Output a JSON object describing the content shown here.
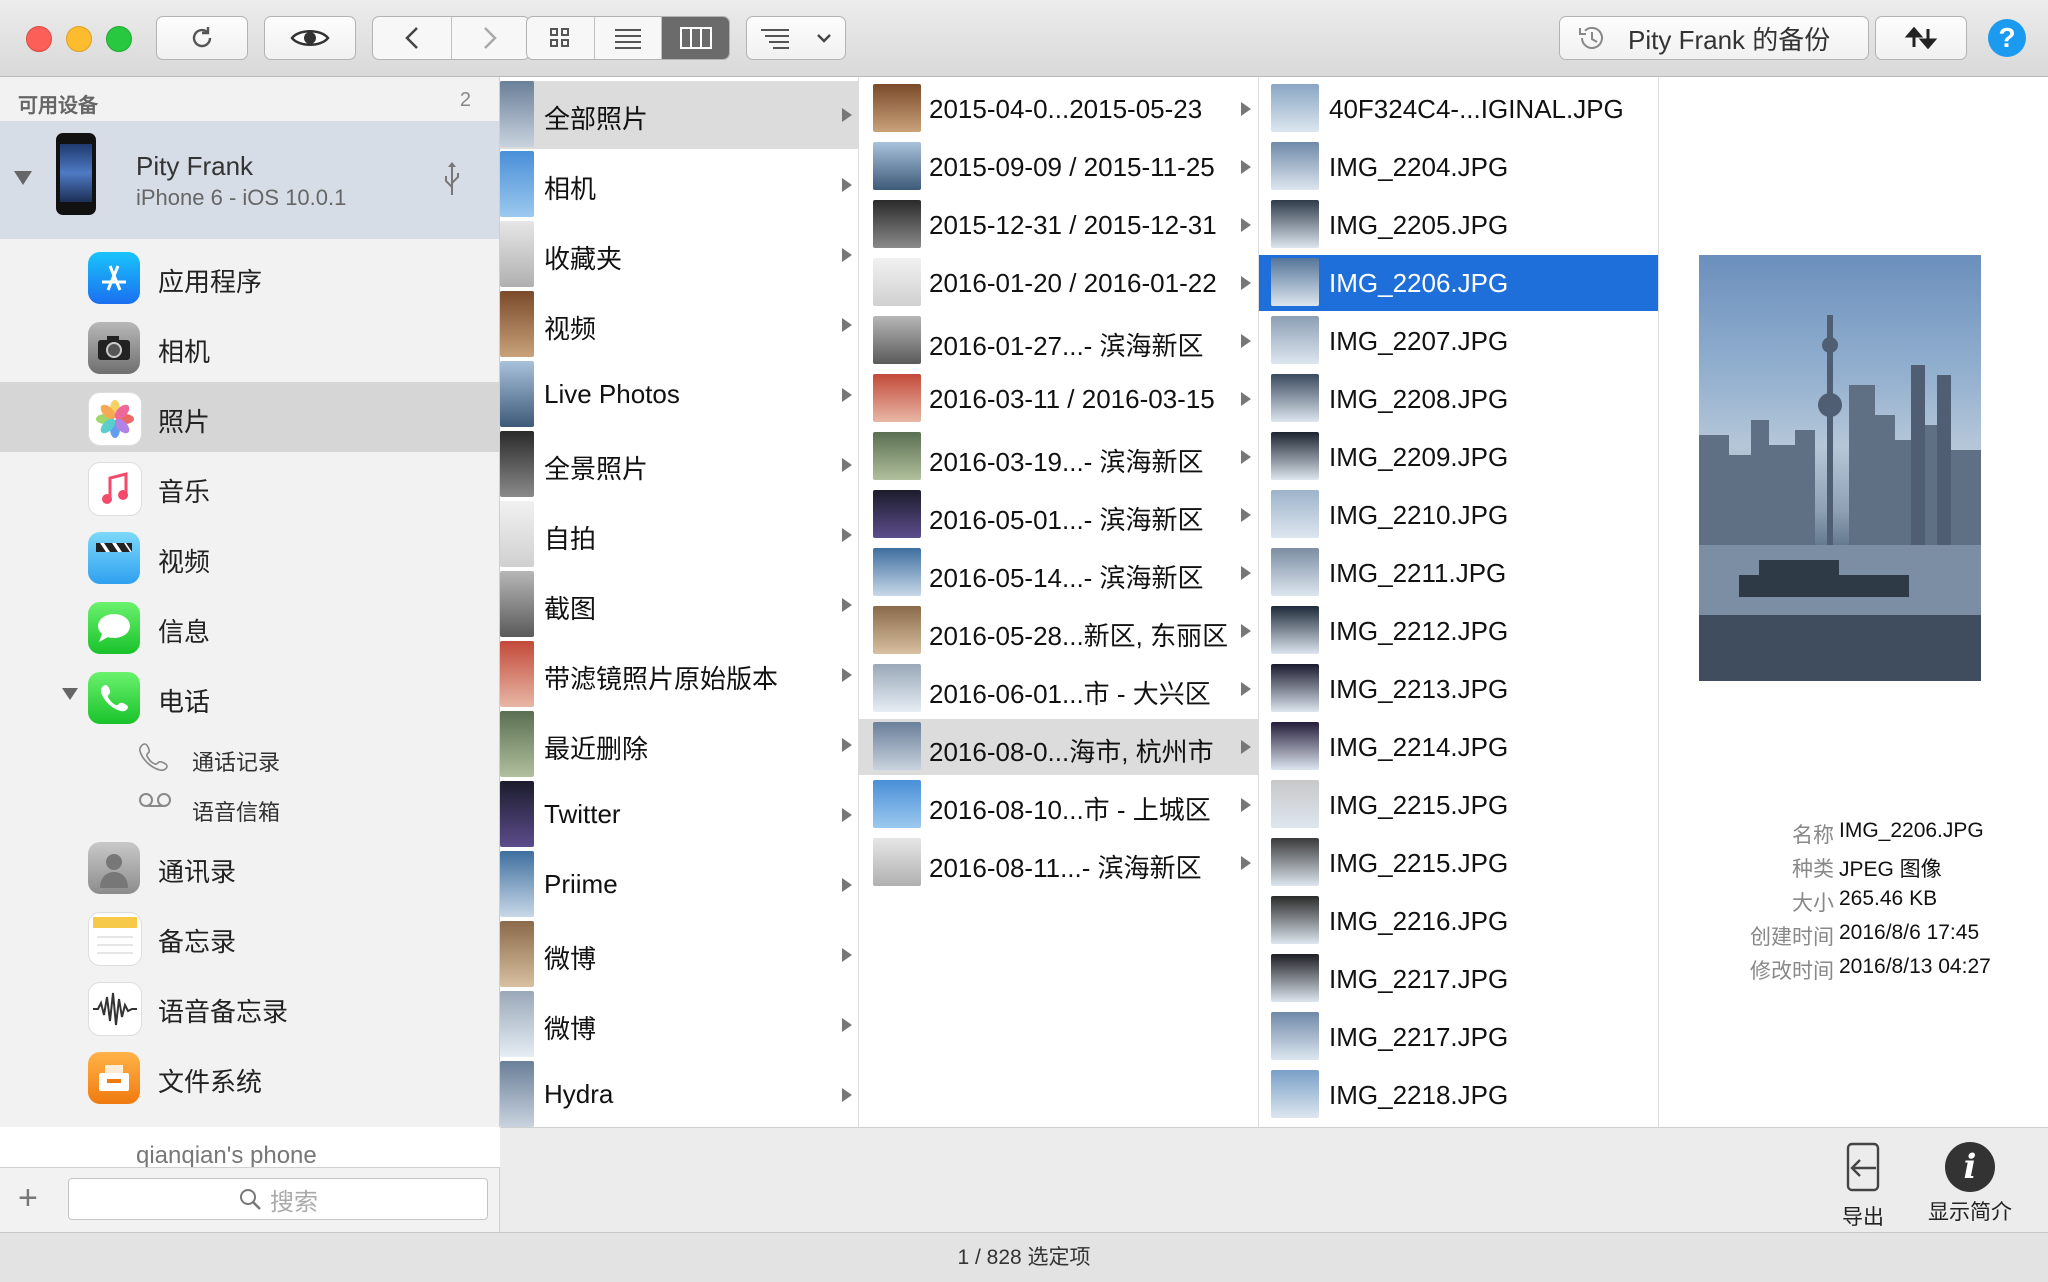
{
  "toolbar": {
    "backup_label": "Pity Frank 的备份"
  },
  "sidebar": {
    "header": "可用设备",
    "count": "2",
    "device": {
      "name": "Pity Frank",
      "model": "iPhone 6 - iOS 10.0.1"
    },
    "items": [
      {
        "label": "应用程序",
        "icon": "app-store-icon"
      },
      {
        "label": "相机",
        "icon": "camera-icon"
      },
      {
        "label": "照片",
        "icon": "photos-icon"
      },
      {
        "label": "音乐",
        "icon": "music-icon"
      },
      {
        "label": "视频",
        "icon": "video-icon"
      },
      {
        "label": "信息",
        "icon": "messages-icon"
      },
      {
        "label": "电话",
        "icon": "phone-icon"
      }
    ],
    "phone_sub": [
      {
        "label": "通话记录",
        "icon": "call-log-icon"
      },
      {
        "label": "语音信箱",
        "icon": "voicemail-icon"
      }
    ],
    "items2": [
      {
        "label": "通讯录",
        "icon": "contacts-icon"
      },
      {
        "label": "备忘录",
        "icon": "notes-icon"
      },
      {
        "label": "语音备忘录",
        "icon": "voice-memo-icon"
      },
      {
        "label": "文件系统",
        "icon": "filesystem-icon"
      }
    ],
    "second_device": "qianqian's phone",
    "search_placeholder": "搜索"
  },
  "albums": [
    "全部照片",
    "相机",
    "收藏夹",
    "视频",
    "Live Photos",
    "全景照片",
    "自拍",
    "截图",
    "带滤镜照片原始版本",
    "最近删除",
    "Twitter",
    "Priime",
    "微博",
    "微博",
    "Hydra"
  ],
  "moments": [
    "2015-04-0...2015-05-23",
    "2015-09-09 / 2015-11-25",
    "2015-12-31 / 2015-12-31",
    "2016-01-20 / 2016-01-22",
    "2016-01-27...- 滨海新区",
    "2016-03-11 / 2016-03-15",
    "2016-03-19...- 滨海新区",
    "2016-05-01...- 滨海新区",
    "2016-05-14...- 滨海新区",
    "2016-05-28...新区, 东丽区",
    "2016-06-01...市 - 大兴区",
    "2016-08-0...海市, 杭州市",
    "2016-08-10...市 - 上城区",
    "2016-08-11...- 滨海新区"
  ],
  "files": [
    "40F324C4-...IGINAL.JPG",
    "IMG_2204.JPG",
    "IMG_2205.JPG",
    "IMG_2206.JPG",
    "IMG_2207.JPG",
    "IMG_2208.JPG",
    "IMG_2209.JPG",
    "IMG_2210.JPG",
    "IMG_2211.JPG",
    "IMG_2212.JPG",
    "IMG_2213.JPG",
    "IMG_2214.JPG",
    "IMG_2215.JPG",
    "IMG_2215.JPG",
    "IMG_2216.JPG",
    "IMG_2217.JPG",
    "IMG_2217.JPG",
    "IMG_2218.JPG"
  ],
  "info": {
    "name_label": "名称",
    "name_value": "IMG_2206.JPG",
    "kind_label": "种类",
    "kind_value": "JPEG 图像",
    "size_label": "大小",
    "size_value": "265.46 KB",
    "created_label": "创建时间",
    "created_value": "2016/8/6 17:45",
    "modified_label": "修改时间",
    "modified_value": "2016/8/13 04:27"
  },
  "actions": {
    "export": "导出",
    "info": "显示简介"
  },
  "status": "1 / 828 选定项",
  "colors": {
    "selection": "#1e6fd9",
    "sidebar_selected": "#d6d6d6",
    "device_selected": "#d6dde7"
  }
}
